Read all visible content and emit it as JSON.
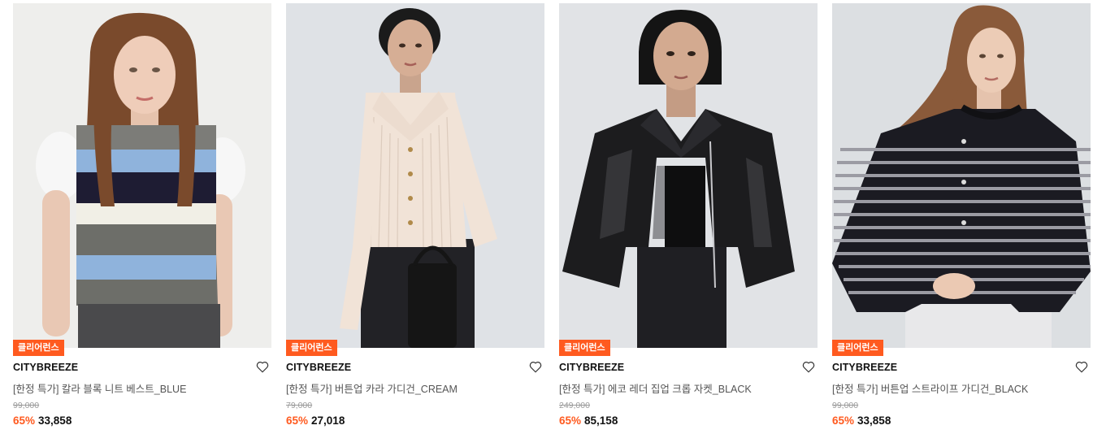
{
  "products": [
    {
      "badge": "클리어런스",
      "brand": "CITYBREEZE",
      "name": "[한정 특가] 칼라 블록 니트 베스트_BLUE",
      "original_price": "99,000",
      "discount": "65%",
      "price": "33,858",
      "image": "model-striped-knit-vest",
      "bg_color": "#eeeeec"
    },
    {
      "badge": "클리어런스",
      "brand": "CITYBREEZE",
      "name": "[한정 특가] 버튼업 카라 가디건_CREAM",
      "original_price": "79,000",
      "discount": "65%",
      "price": "27,018",
      "image": "model-cream-ribbed-cardigan",
      "bg_color": "#dfe2e6"
    },
    {
      "badge": "클리어런스",
      "brand": "CITYBREEZE",
      "name": "[한정 특가] 에코 레더 집업 크롭 자켓_BLACK",
      "original_price": "249,000",
      "discount": "65%",
      "price": "85,158",
      "image": "model-black-leather-jacket",
      "bg_color": "#e1e3e6"
    },
    {
      "badge": "클리어런스",
      "brand": "CITYBREEZE",
      "name": "[한정 특가] 버튼업 스트라이프 가디건_BLACK",
      "original_price": "99,000",
      "discount": "65%",
      "price": "33,858",
      "image": "model-striped-cardigan",
      "bg_color": "#dcdfe2"
    }
  ],
  "accent_color": "#ff5a1f",
  "wishlist_icon": "heart-outline-icon"
}
